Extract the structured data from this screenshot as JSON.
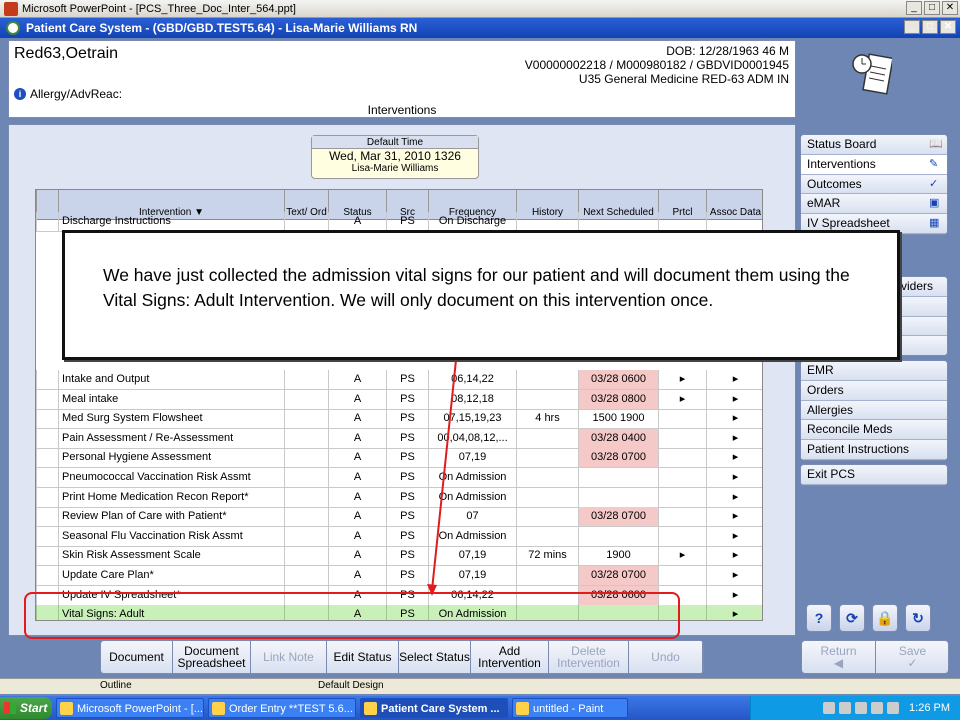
{
  "ppt_window": {
    "title": "Microsoft PowerPoint - [PCS_Three_Doc_Inter_564.ppt]"
  },
  "pcs_window": {
    "title": "Patient Care System - (GBD/GBD.TEST5.64) - Lisa-Marie Williams RN"
  },
  "patient": {
    "name": "Red63,Oetrain",
    "dob": "DOB: 12/28/1963 46 M",
    "ids": "V00000002218 / M000980182 / GBDVID0001945",
    "location": "U35 General Medicine  RED-63  ADM IN",
    "allergy_label": "Allergy/AdvReac:",
    "section_title": "Interventions"
  },
  "default_time": {
    "header": "Default Time",
    "value": "Wed, Mar 31, 2010  1326",
    "user": "Lisa-Marie Williams"
  },
  "table": {
    "headers": {
      "intervention": "Intervention ▼",
      "text_ord": "Text/ Ord",
      "status": "Status",
      "src": "Src",
      "frequency": "Frequency",
      "history": "History",
      "next": "Next Scheduled",
      "prtcl": "Prtcl",
      "assoc": "Assoc Data"
    },
    "top_row": {
      "name": "Discharge Instructions",
      "status": "A",
      "src": "PS",
      "freq": "On Discharge"
    },
    "rows": [
      {
        "name": "Intake and Output",
        "status": "A",
        "src": "PS",
        "freq": "06,14,22",
        "history": "",
        "next": "03/28 0600",
        "next_red": true,
        "prtcl": "▸",
        "assoc": "▸"
      },
      {
        "name": "Meal intake",
        "status": "A",
        "src": "PS",
        "freq": "08,12,18",
        "history": "",
        "next": "03/28 0800",
        "next_red": true,
        "prtcl": "▸",
        "assoc": "▸"
      },
      {
        "name": "Med Surg System Flowsheet",
        "status": "A",
        "src": "PS",
        "freq": "07,15,19,23",
        "history": "4 hrs",
        "next": "1500 1900",
        "next_red": false,
        "prtcl": "",
        "assoc": "▸"
      },
      {
        "name": "Pain Assessment / Re-Assessment",
        "status": "A",
        "src": "PS",
        "freq": "00,04,08,12,...",
        "history": "",
        "next": "03/28 0400",
        "next_red": true,
        "prtcl": "",
        "assoc": "▸"
      },
      {
        "name": "Personal Hygiene Assessment",
        "status": "A",
        "src": "PS",
        "freq": "07,19",
        "history": "",
        "next": "03/28 0700",
        "next_red": true,
        "prtcl": "",
        "assoc": "▸"
      },
      {
        "name": "Pneumococcal Vaccination Risk Assmt",
        "status": "A",
        "src": "PS",
        "freq": "On Admission",
        "history": "",
        "next": "",
        "next_red": false,
        "prtcl": "",
        "assoc": "▸"
      },
      {
        "name": "Print Home Medication Recon Report*",
        "status": "A",
        "src": "PS",
        "freq": "On Admission",
        "history": "",
        "next": "",
        "next_red": false,
        "prtcl": "",
        "assoc": "▸"
      },
      {
        "name": "Review Plan of Care with Patient*",
        "status": "A",
        "src": "PS",
        "freq": "07",
        "history": "",
        "next": "03/28 0700",
        "next_red": true,
        "prtcl": "",
        "assoc": "▸"
      },
      {
        "name": "Seasonal Flu Vaccination Risk Assmt",
        "status": "A",
        "src": "PS",
        "freq": "On Admission",
        "history": "",
        "next": "",
        "next_red": false,
        "prtcl": "",
        "assoc": "▸"
      },
      {
        "name": "Skin Risk Assessment Scale",
        "status": "A",
        "src": "PS",
        "freq": "07,19",
        "history": "72 mins",
        "next": "1900",
        "next_red": false,
        "prtcl": "▸",
        "assoc": "▸"
      },
      {
        "name": "Update Care Plan*",
        "status": "A",
        "src": "PS",
        "freq": "07,19",
        "history": "",
        "next": "03/28 0700",
        "next_red": true,
        "prtcl": "",
        "assoc": "▸"
      },
      {
        "name": "Update IV Spreadsheet*",
        "status": "A",
        "src": "PS",
        "freq": "06,14,22",
        "history": "",
        "next": "03/28 0600",
        "next_red": true,
        "prtcl": "",
        "assoc": "▸"
      },
      {
        "name": "Vital Signs: Adult",
        "status": "A",
        "src": "PS",
        "freq": "On Admission",
        "history": "",
        "next": "",
        "next_red": false,
        "prtcl": "",
        "assoc": "▸",
        "highlight": true
      }
    ]
  },
  "nav": {
    "group1": [
      {
        "label": "Status Board",
        "icon": "📖"
      },
      {
        "label": "Interventions",
        "icon": "✎"
      },
      {
        "label": "Outcomes",
        "icon": "✓"
      },
      {
        "label": "eMAR",
        "icon": "▣"
      },
      {
        "label": "IV Spreadsheet",
        "icon": "▦"
      }
    ],
    "group1_partial": {
      "label": "viders"
    },
    "group2": [
      {
        "label": "EMR"
      },
      {
        "label": "Orders"
      },
      {
        "label": "Allergies"
      },
      {
        "label": "Reconcile Meds"
      },
      {
        "label": "Patient Instructions"
      }
    ],
    "exit": "Exit PCS"
  },
  "tool_buttons": [
    "?",
    "⟳",
    "🔒",
    "↻"
  ],
  "actions": {
    "document": "Document",
    "document_spreadsheet": "Document Spreadsheet",
    "link_note": "Link Note",
    "edit_status": "Edit Status",
    "select_status": "Select Status",
    "add_intervention": "Add Intervention",
    "delete_intervention": "Delete Intervention",
    "undo": "Undo",
    "return": "Return",
    "save": "Save"
  },
  "callout": {
    "text": "We have just collected the admission vital signs for our patient and will document them using the Vital Signs: Adult Intervention. We will only document on this intervention once."
  },
  "ppt_status": {
    "outline": "Outline",
    "design": "Default Design"
  },
  "taskbar": {
    "start": "Start",
    "tasks": [
      {
        "label": "Microsoft PowerPoint - [..."
      },
      {
        "label": "Order Entry **TEST 5.6..."
      },
      {
        "label": "Patient Care System ...",
        "active": true
      },
      {
        "label": "untitled - Paint"
      }
    ],
    "clock": "1:26 PM"
  },
  "colors": {
    "red_overdue": "#f6c9c9",
    "highlight_green": "#c8f0b8",
    "callout_arrow": "#e01c1c"
  }
}
